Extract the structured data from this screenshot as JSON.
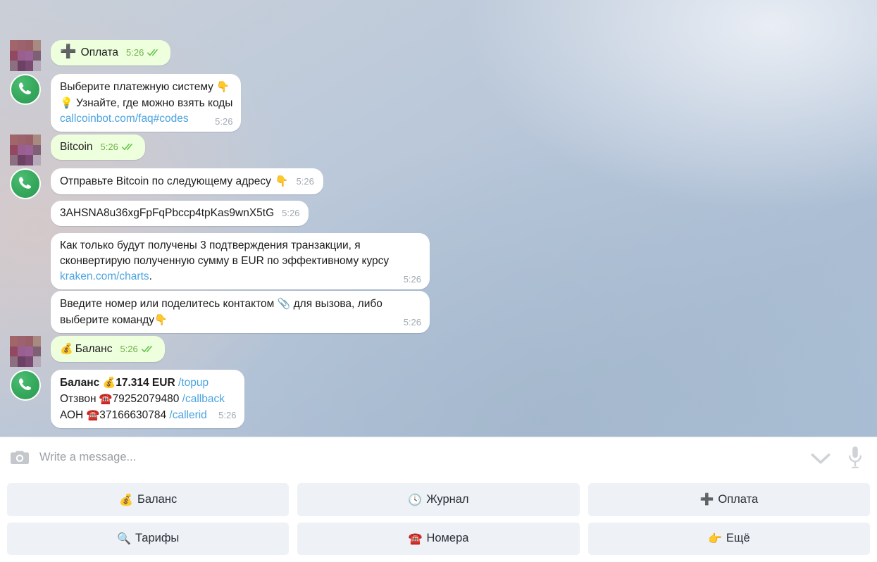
{
  "theme": {
    "outgoing_bubble_color": "#eeffdd",
    "incoming_bubble_color": "#ffffff",
    "link_color": "#4aa3df",
    "outgoing_meta_color": "#6eb048",
    "incoming_meta_color": "#a1aab3",
    "bot_avatar_color": "#35a85c",
    "keyboard_button_color": "#eef1f6"
  },
  "messages": [
    {
      "id": "m1",
      "direction": "out",
      "layout": "inline",
      "avatar": "user-pixelated",
      "emoji": "➕",
      "text": "Оплата",
      "time": "5:26",
      "status": "read"
    },
    {
      "id": "m2",
      "direction": "in",
      "layout": "block",
      "avatar": "bot-phone",
      "line1": "Выберите платежную систему",
      "emoji1": "👇",
      "emoji2": "💡",
      "line2": "Узнайте, где можно взять коды",
      "link": "callcoinbot.com/faq#codes",
      "time": "5:26"
    },
    {
      "id": "m3",
      "direction": "out",
      "layout": "inline",
      "avatar": "user-pixelated",
      "text": "Bitcoin",
      "time": "5:26",
      "status": "read"
    },
    {
      "id": "m4",
      "direction": "in",
      "layout": "inline",
      "avatar": "bot-phone",
      "text": "Отправьте Bitcoin по следующему адресу",
      "emoji": "👇",
      "time": "5:26"
    },
    {
      "id": "m5",
      "direction": "in",
      "layout": "inline",
      "avatar": "none",
      "text": "3AHSNA8u36xgFpFqPbccp4tpKas9wnX5tG",
      "time": "5:26"
    },
    {
      "id": "m6",
      "direction": "in",
      "layout": "block",
      "avatar": "none",
      "line1": "Как только будут получены 3 подтверждения транзакции, я сконвертирую полученную сумму в EUR по эффективному курсу",
      "link": "kraken.com/charts",
      "suffix": ".",
      "time": "5:26"
    },
    {
      "id": "m7",
      "direction": "in",
      "layout": "block",
      "avatar": "none",
      "part1": "Введите номер или поделитесь контактом",
      "emoji1": "📎",
      "part2": "для вызова, либо выберите команду",
      "emoji2": "👇",
      "time": "5:26"
    },
    {
      "id": "m8",
      "direction": "out",
      "layout": "inline",
      "avatar": "user-pixelated",
      "emoji": "💰",
      "text": "Баланс",
      "time": "5:26",
      "status": "read"
    },
    {
      "id": "m9",
      "direction": "in",
      "layout": "block",
      "avatar": "bot-phone",
      "balance_label": "Баланс",
      "balance_emoji": "💰",
      "balance_value": "17.314 EUR",
      "balance_cmd": "/topup",
      "callback_label": "Отзвон",
      "callback_emoji": "☎️",
      "callback_number": "79252079480",
      "callback_cmd": "/callback",
      "callerid_label": "АОН",
      "callerid_emoji": "☎️",
      "callerid_number": "37166630784",
      "callerid_cmd": "/callerid",
      "time": "5:26"
    }
  ],
  "composer": {
    "placeholder": "Write a message...",
    "value": "",
    "camera_icon": "camera-icon",
    "chevron_icon": "chevron-down-icon",
    "mic_icon": "microphone-icon"
  },
  "keyboard": {
    "rows": [
      [
        {
          "emoji": "💰",
          "label": "Баланс"
        },
        {
          "emoji": "🕓",
          "label": "Журнал"
        },
        {
          "emoji": "➕",
          "label": "Оплата"
        }
      ],
      [
        {
          "emoji": "🔍",
          "label": "Тарифы"
        },
        {
          "emoji": "☎️",
          "label": "Номера"
        },
        {
          "emoji": "👉",
          "label": "Ещё"
        }
      ]
    ]
  }
}
